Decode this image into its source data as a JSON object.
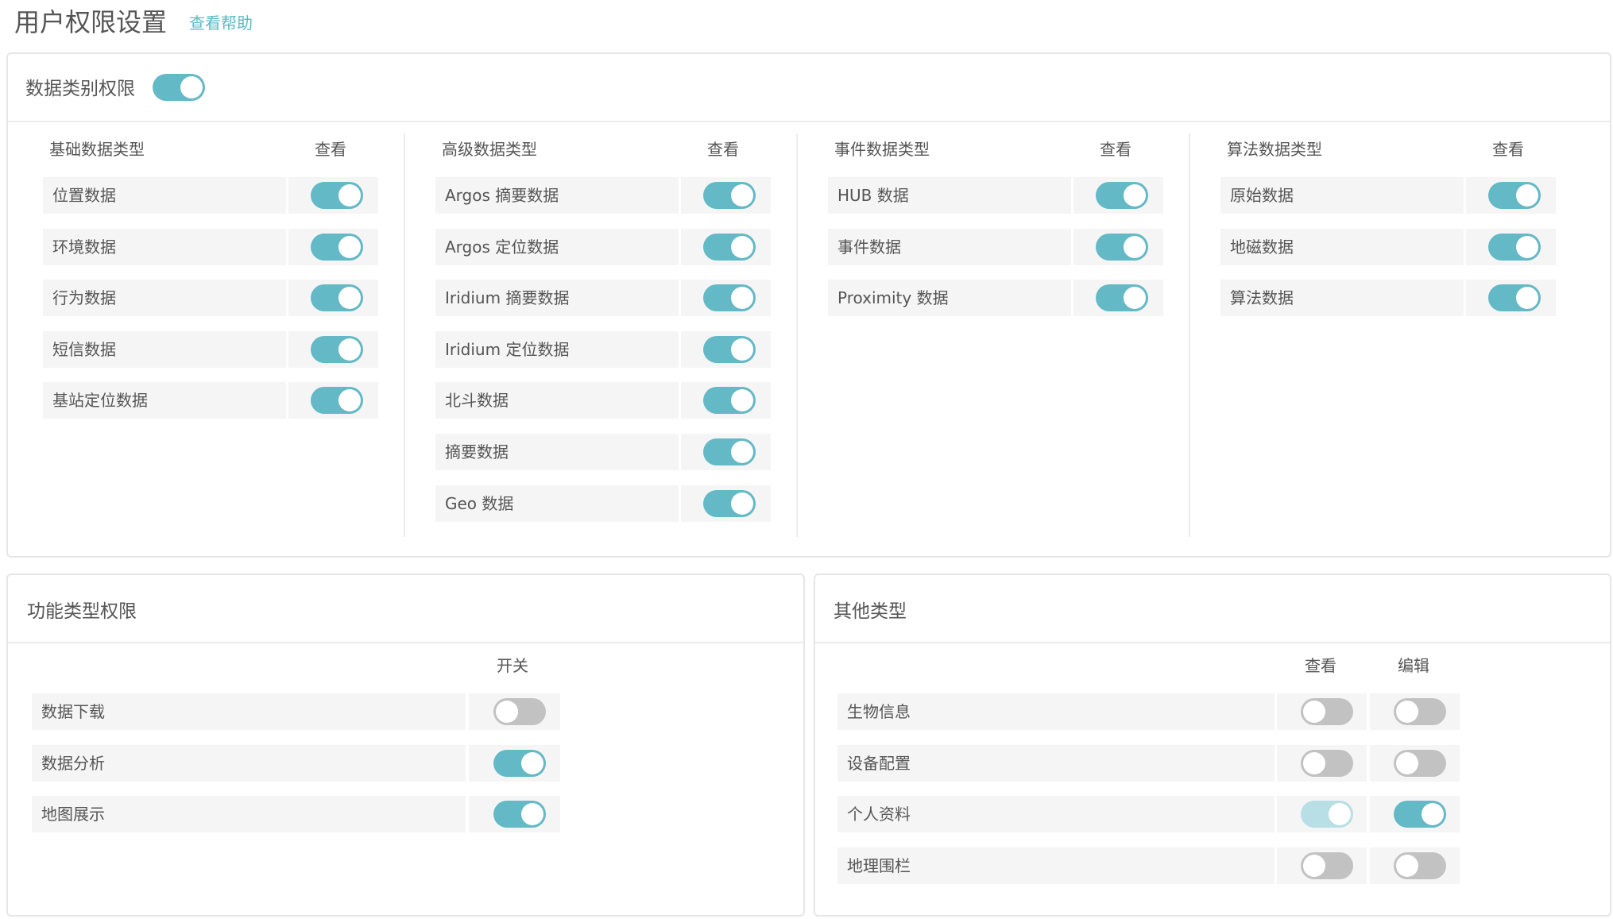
{
  "header": {
    "title": "用户权限设置",
    "help_link": "查看帮助"
  },
  "data_panel": {
    "title": "数据类别权限",
    "master_toggle": true,
    "columns": [
      {
        "header": "基础数据类型",
        "view_label": "查看",
        "items": [
          {
            "label": "位置数据",
            "view": true
          },
          {
            "label": "环境数据",
            "view": true
          },
          {
            "label": "行为数据",
            "view": true
          },
          {
            "label": "短信数据",
            "view": true
          },
          {
            "label": "基站定位数据",
            "view": true
          }
        ]
      },
      {
        "header": "高级数据类型",
        "view_label": "查看",
        "items": [
          {
            "label": "Argos 摘要数据",
            "view": true
          },
          {
            "label": "Argos 定位数据",
            "view": true
          },
          {
            "label": "Iridium 摘要数据",
            "view": true
          },
          {
            "label": "Iridium 定位数据",
            "view": true
          },
          {
            "label": "北斗数据",
            "view": true
          },
          {
            "label": "摘要数据",
            "view": true
          },
          {
            "label": "Geo 数据",
            "view": true
          }
        ]
      },
      {
        "header": "事件数据类型",
        "view_label": "查看",
        "items": [
          {
            "label": "HUB 数据",
            "view": true
          },
          {
            "label": "事件数据",
            "view": true
          },
          {
            "label": "Proximity 数据",
            "view": true
          }
        ]
      },
      {
        "header": "算法数据类型",
        "view_label": "查看",
        "items": [
          {
            "label": "原始数据",
            "view": true
          },
          {
            "label": "地磁数据",
            "view": true
          },
          {
            "label": "算法数据",
            "view": true
          }
        ]
      }
    ]
  },
  "function_panel": {
    "title": "功能类型权限",
    "switch_label": "开关",
    "items": [
      {
        "label": "数据下载",
        "enabled": false
      },
      {
        "label": "数据分析",
        "enabled": true
      },
      {
        "label": "地图展示",
        "enabled": true
      }
    ]
  },
  "other_panel": {
    "title": "其他类型",
    "view_label": "查看",
    "edit_label": "编辑",
    "items": [
      {
        "label": "生物信息",
        "view": "off",
        "edit": "off"
      },
      {
        "label": "设备配置",
        "view": "off",
        "edit": "off"
      },
      {
        "label": "个人资料",
        "view": "disabled-on",
        "edit": "on"
      },
      {
        "label": "地理围栏",
        "view": "off",
        "edit": "off"
      }
    ]
  },
  "colors": {
    "accent": "#64b9c6",
    "accent_disabled": "#b7dfe5",
    "toggle_off": "#c2c2c2",
    "row_bg": "#f5f5f5",
    "link": "#5fb8c4"
  }
}
